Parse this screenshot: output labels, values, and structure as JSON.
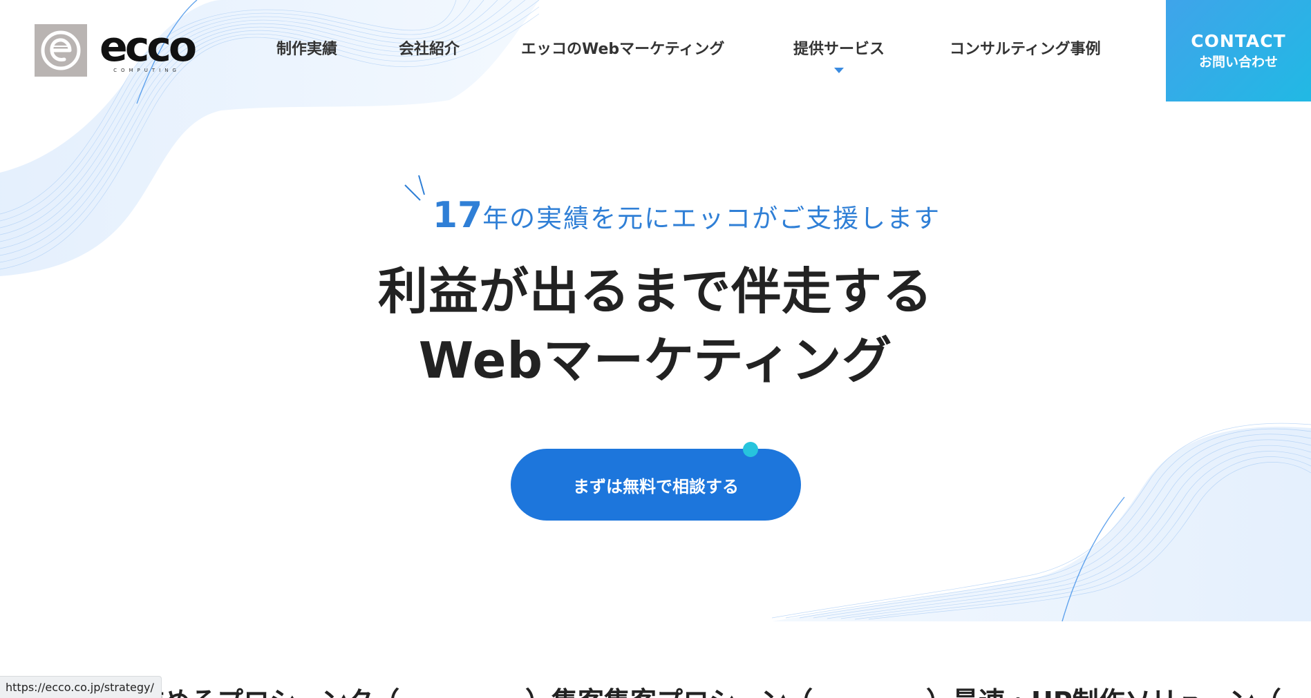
{
  "site": {
    "logo_text": "ecco",
    "logo_sub": "COMPUTING",
    "accent_color": "#1d76dc",
    "contact_gradient": [
      "#3fa4ea",
      "#21b9e4"
    ]
  },
  "nav": {
    "items": [
      {
        "label": "制作実績"
      },
      {
        "label": "会社紹介"
      },
      {
        "label": "エッコのWebマーケティング"
      },
      {
        "label": "提供サービス"
      },
      {
        "label": "コンサルティング事例"
      }
    ],
    "contact_en": "CONTACT",
    "contact_jp": "お問い合わせ"
  },
  "hero": {
    "tagline_number": "17",
    "tagline_rest": "年の実績を元にエッコがご支援します",
    "headline_line1": "利益が出るまで伴走する",
    "headline_line2": "Webマーケティング",
    "cta_label": "まずは無料で相談する"
  },
  "bottom_strip": {
    "fragments": [
      "求めるプロシーンタ（",
      "）集客集客プロシーン（",
      "）最速・HP制作ソリューン（"
    ]
  },
  "status_bar": {
    "url": "https://ecco.co.jp/strategy/"
  },
  "icons": [
    "ecco-logo-icon",
    "sparkle-icon",
    "dropdown-caret-icon"
  ]
}
